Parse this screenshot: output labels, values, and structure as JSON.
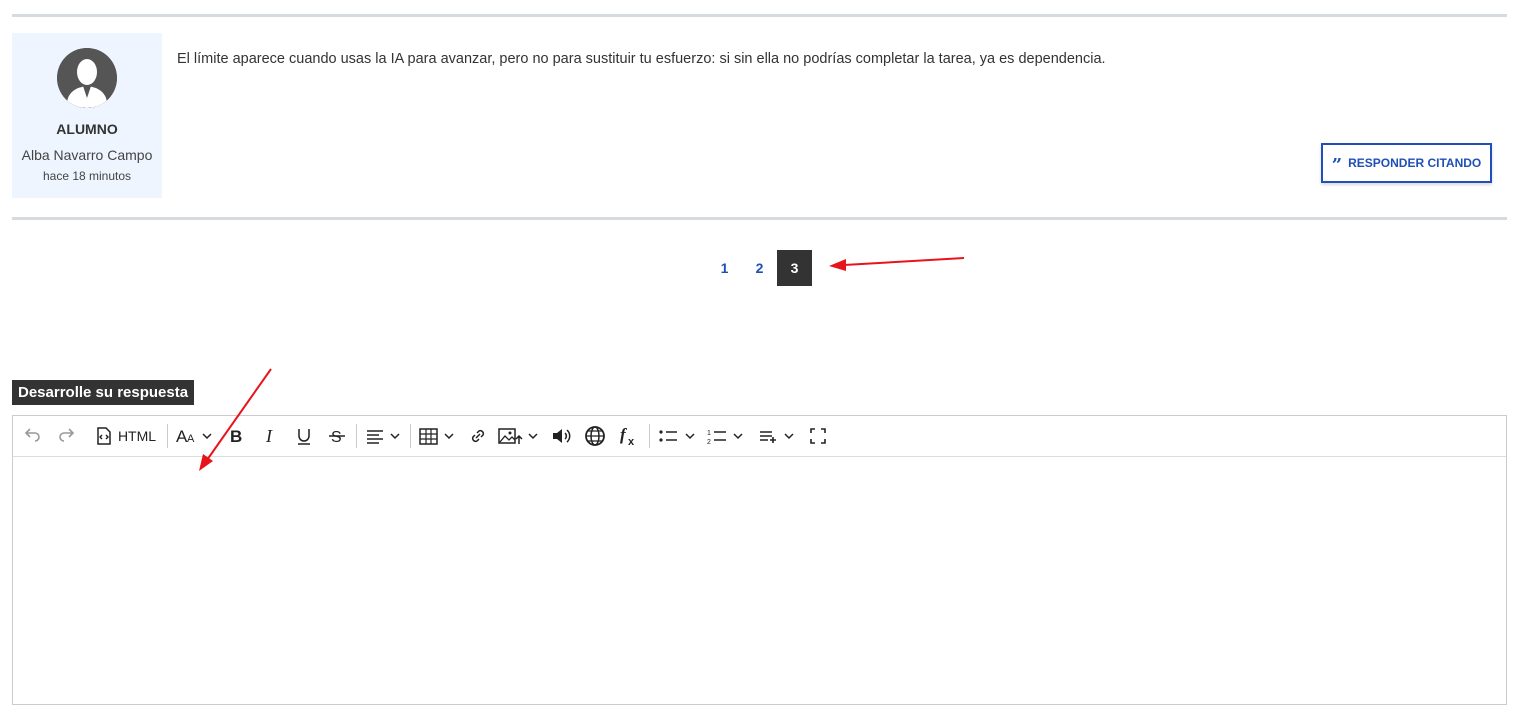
{
  "post": {
    "role": "ALUMNO",
    "author": "Alba Navarro Campo",
    "time": "hace 18 minutos",
    "text": "El límite aparece cuando usas la IA para avanzar, pero no para sustituir tu esfuerzo: si sin ella no podrías completar la tarea, ya es dependencia.",
    "quote_button_label": "RESPONDER CITANDO",
    "quote_icon": "quote-icon"
  },
  "pagination": {
    "pages": [
      "1",
      "2",
      "3"
    ],
    "current": "3"
  },
  "reply": {
    "label": "Desarrolle su respuesta",
    "toolbar": {
      "html_label": "HTML"
    },
    "content": ""
  },
  "colors": {
    "accent": "#1f4fb8",
    "dark": "#333333",
    "card_bg": "#eef5ff",
    "annotation_arrow": "#e8141c"
  }
}
